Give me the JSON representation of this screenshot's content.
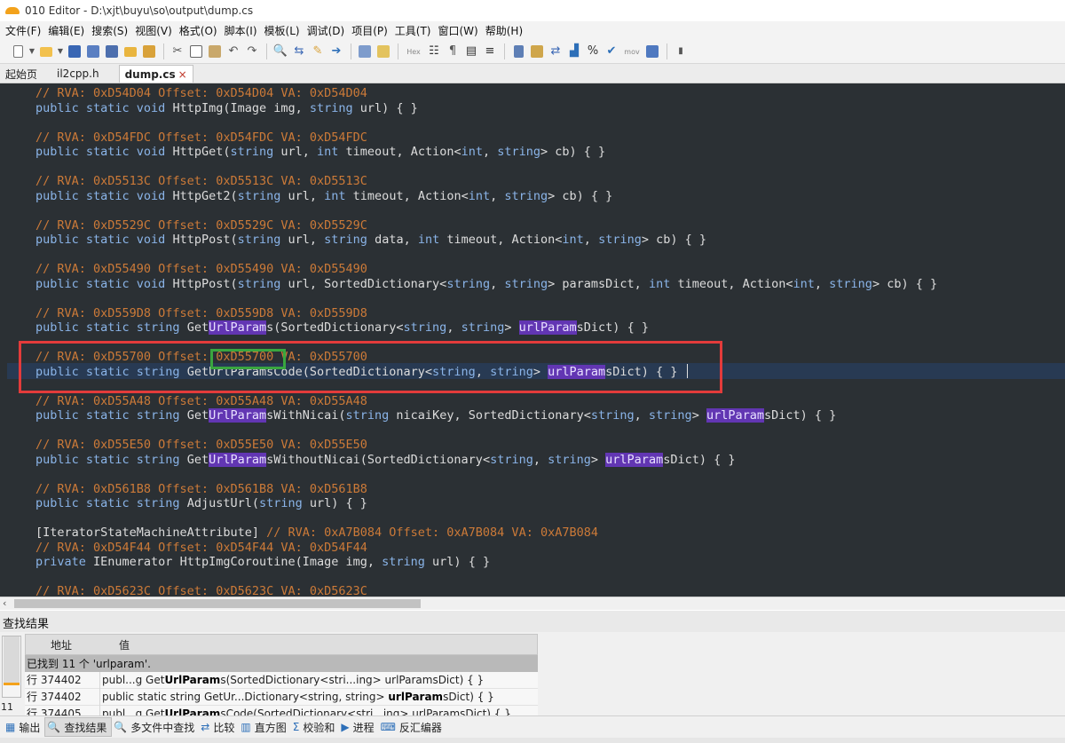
{
  "window": {
    "title": "010 Editor - D:\\xjt\\buyu\\so\\output\\dump.cs"
  },
  "menu": [
    "文件(F)",
    "编辑(E)",
    "搜索(S)",
    "视图(V)",
    "格式(O)",
    "脚本(I)",
    "模板(L)",
    "调试(D)",
    "项目(P)",
    "工具(T)",
    "窗口(W)",
    "帮助(H)"
  ],
  "toolbar": {
    "labels": [
      "Hex",
      "mov"
    ]
  },
  "tabs": [
    {
      "label": "起始页"
    },
    {
      "label": "il2cpp.h"
    },
    {
      "label": "dump.cs",
      "close": "×"
    }
  ],
  "code_lines": [
    [
      {
        "t": "// RVA: 0xD54D04 Offset: 0xD54D04 VA: 0xD54D04",
        "c": "c"
      }
    ],
    [
      {
        "t": "public static void ",
        "c": "k"
      },
      {
        "t": "HttpImg(Image img, ",
        "c": "p"
      },
      {
        "t": "string",
        "c": "k"
      },
      {
        "t": " url) { }",
        "c": "p"
      }
    ],
    [
      {
        "t": "// RVA: 0xD54FDC Offset: 0xD54FDC VA: 0xD54FDC",
        "c": "c"
      }
    ],
    [
      {
        "t": "public static void ",
        "c": "k"
      },
      {
        "t": "HttpGet(",
        "c": "p"
      },
      {
        "t": "string",
        "c": "k"
      },
      {
        "t": " url, ",
        "c": "p"
      },
      {
        "t": "int",
        "c": "k"
      },
      {
        "t": " timeout, Action<",
        "c": "p"
      },
      {
        "t": "int",
        "c": "k"
      },
      {
        "t": ", ",
        "c": "p"
      },
      {
        "t": "string",
        "c": "k"
      },
      {
        "t": "> cb) { }",
        "c": "p"
      }
    ],
    [
      {
        "t": "// RVA: 0xD5513C Offset: 0xD5513C VA: 0xD5513C",
        "c": "c"
      }
    ],
    [
      {
        "t": "public static void ",
        "c": "k"
      },
      {
        "t": "HttpGet2(",
        "c": "p"
      },
      {
        "t": "string",
        "c": "k"
      },
      {
        "t": " url, ",
        "c": "p"
      },
      {
        "t": "int",
        "c": "k"
      },
      {
        "t": " timeout, Action<",
        "c": "p"
      },
      {
        "t": "int",
        "c": "k"
      },
      {
        "t": ", ",
        "c": "p"
      },
      {
        "t": "string",
        "c": "k"
      },
      {
        "t": "> cb) { }",
        "c": "p"
      }
    ],
    [
      {
        "t": "// RVA: 0xD5529C Offset: 0xD5529C VA: 0xD5529C",
        "c": "c"
      }
    ],
    [
      {
        "t": "public static void ",
        "c": "k"
      },
      {
        "t": "HttpPost(",
        "c": "p"
      },
      {
        "t": "string",
        "c": "k"
      },
      {
        "t": " url, ",
        "c": "p"
      },
      {
        "t": "string",
        "c": "k"
      },
      {
        "t": " data, ",
        "c": "p"
      },
      {
        "t": "int",
        "c": "k"
      },
      {
        "t": " timeout, Action<",
        "c": "p"
      },
      {
        "t": "int",
        "c": "k"
      },
      {
        "t": ", ",
        "c": "p"
      },
      {
        "t": "string",
        "c": "k"
      },
      {
        "t": "> cb) { }",
        "c": "p"
      }
    ],
    [
      {
        "t": "// RVA: 0xD55490 Offset: 0xD55490 VA: 0xD55490",
        "c": "c"
      }
    ],
    [
      {
        "t": "public static void ",
        "c": "k"
      },
      {
        "t": "HttpPost(",
        "c": "p"
      },
      {
        "t": "string",
        "c": "k"
      },
      {
        "t": " url, SortedDictionary<",
        "c": "p"
      },
      {
        "t": "string",
        "c": "k"
      },
      {
        "t": ", ",
        "c": "p"
      },
      {
        "t": "string",
        "c": "k"
      },
      {
        "t": "> paramsDict, ",
        "c": "p"
      },
      {
        "t": "int",
        "c": "k"
      },
      {
        "t": " timeout, Action<",
        "c": "p"
      },
      {
        "t": "int",
        "c": "k"
      },
      {
        "t": ", ",
        "c": "p"
      },
      {
        "t": "string",
        "c": "k"
      },
      {
        "t": "> cb) { }",
        "c": "p"
      }
    ],
    [
      {
        "t": "// RVA: 0xD559D8 Offset: 0xD559D8 VA: 0xD559D8",
        "c": "c"
      }
    ],
    [
      {
        "t": "public static string ",
        "c": "k"
      },
      {
        "t": "Get",
        "c": "p"
      },
      {
        "t": "UrlParam",
        "c": "hl"
      },
      {
        "t": "s(SortedDictionary<",
        "c": "p"
      },
      {
        "t": "string",
        "c": "k"
      },
      {
        "t": ", ",
        "c": "p"
      },
      {
        "t": "string",
        "c": "k"
      },
      {
        "t": "> ",
        "c": "p"
      },
      {
        "t": "urlParam",
        "c": "hl"
      },
      {
        "t": "sDict) { }",
        "c": "p"
      }
    ],
    [
      {
        "t": "// RVA: 0xD55700 Offset: 0xD55700 VA: 0xD55700",
        "c": "c"
      }
    ],
    [
      {
        "t": "public static string ",
        "c": "k"
      },
      {
        "t": "GetUrlParamsCode(SortedDictionary<",
        "c": "p"
      },
      {
        "t": "string",
        "c": "k"
      },
      {
        "t": ", ",
        "c": "p"
      },
      {
        "t": "string",
        "c": "k"
      },
      {
        "t": "> ",
        "c": "p"
      },
      {
        "t": "urlParam",
        "c": "hl"
      },
      {
        "t": "sDict) { }",
        "c": "p"
      }
    ],
    [
      {
        "t": "// RVA: 0xD55A48 Offset: 0xD55A48 VA: 0xD55A48",
        "c": "c"
      }
    ],
    [
      {
        "t": "public static string ",
        "c": "k"
      },
      {
        "t": "Get",
        "c": "p"
      },
      {
        "t": "UrlParam",
        "c": "hl"
      },
      {
        "t": "sWithNicai(",
        "c": "p"
      },
      {
        "t": "string",
        "c": "k"
      },
      {
        "t": " nicaiKey, SortedDictionary<",
        "c": "p"
      },
      {
        "t": "string",
        "c": "k"
      },
      {
        "t": ", ",
        "c": "p"
      },
      {
        "t": "string",
        "c": "k"
      },
      {
        "t": "> ",
        "c": "p"
      },
      {
        "t": "urlParam",
        "c": "hl"
      },
      {
        "t": "sDict) { }",
        "c": "p"
      }
    ],
    [
      {
        "t": "// RVA: 0xD55E50 Offset: 0xD55E50 VA: 0xD55E50",
        "c": "c"
      }
    ],
    [
      {
        "t": "public static string ",
        "c": "k"
      },
      {
        "t": "Get",
        "c": "p"
      },
      {
        "t": "UrlParam",
        "c": "hl"
      },
      {
        "t": "sWithoutNicai(SortedDictionary<",
        "c": "p"
      },
      {
        "t": "string",
        "c": "k"
      },
      {
        "t": ", ",
        "c": "p"
      },
      {
        "t": "string",
        "c": "k"
      },
      {
        "t": "> ",
        "c": "p"
      },
      {
        "t": "urlParam",
        "c": "hl"
      },
      {
        "t": "sDict) { }",
        "c": "p"
      }
    ],
    [
      {
        "t": "// RVA: 0xD561B8 Offset: 0xD561B8 VA: 0xD561B8",
        "c": "c"
      }
    ],
    [
      {
        "t": "public static string ",
        "c": "k"
      },
      {
        "t": "AdjustUrl(",
        "c": "p"
      },
      {
        "t": "string",
        "c": "k"
      },
      {
        "t": " url) { }",
        "c": "p"
      }
    ],
    [
      {
        "t": "[IteratorStateMachineAttribute] ",
        "c": "p"
      },
      {
        "t": "// RVA: 0xA7B084 Offset: 0xA7B084 VA: 0xA7B084",
        "c": "c"
      }
    ],
    [
      {
        "t": "// RVA: 0xD54F44 Offset: 0xD54F44 VA: 0xD54F44",
        "c": "c"
      }
    ],
    [
      {
        "t": "private ",
        "c": "k"
      },
      {
        "t": "IEnumerator HttpImgCoroutine(Image img, ",
        "c": "p"
      },
      {
        "t": "string",
        "c": "k"
      },
      {
        "t": " url) { }",
        "c": "p"
      }
    ],
    [
      {
        "t": "// RVA: 0xD5623C Offset: 0xD5623C VA: 0xD5623C",
        "c": "c"
      }
    ]
  ],
  "scrollbar": {
    "left_arrow": "‹"
  },
  "find_panel": {
    "title": "查找结果",
    "col_address": "地址",
    "col_value": "值",
    "summary": "已找到 11 个 'urlparam'.",
    "line_number": "11",
    "rows": [
      {
        "addr": "行 374402",
        "pre": "publ...g Get",
        "bold": "UrlParam",
        "post": "s(SortedDictionary<stri...ing> urlParamsDict) { }"
      },
      {
        "addr": "行 374402",
        "pre": "public static string GetUr...Dictionary<string, string> ",
        "bold": "urlParam",
        "post": "sDict) { }"
      },
      {
        "addr": "行 374405",
        "pre": "publ...g Get",
        "bold": "UrlParam",
        "post": "sCode(SortedDictionary<stri...ing> urlParamsDict) { }"
      }
    ]
  },
  "bottom_tabs": [
    {
      "label": "输出",
      "icon": "▦"
    },
    {
      "label": "查找结果",
      "icon": "🔍"
    },
    {
      "label": "多文件中查找",
      "icon": "🔍"
    },
    {
      "label": "比较",
      "icon": "⇄"
    },
    {
      "label": "直方图",
      "icon": "▥"
    },
    {
      "label": "校验和",
      "icon": "Σ"
    },
    {
      "label": "进程",
      "icon": "▶"
    },
    {
      "label": "反汇编器",
      "icon": "⌨"
    }
  ]
}
